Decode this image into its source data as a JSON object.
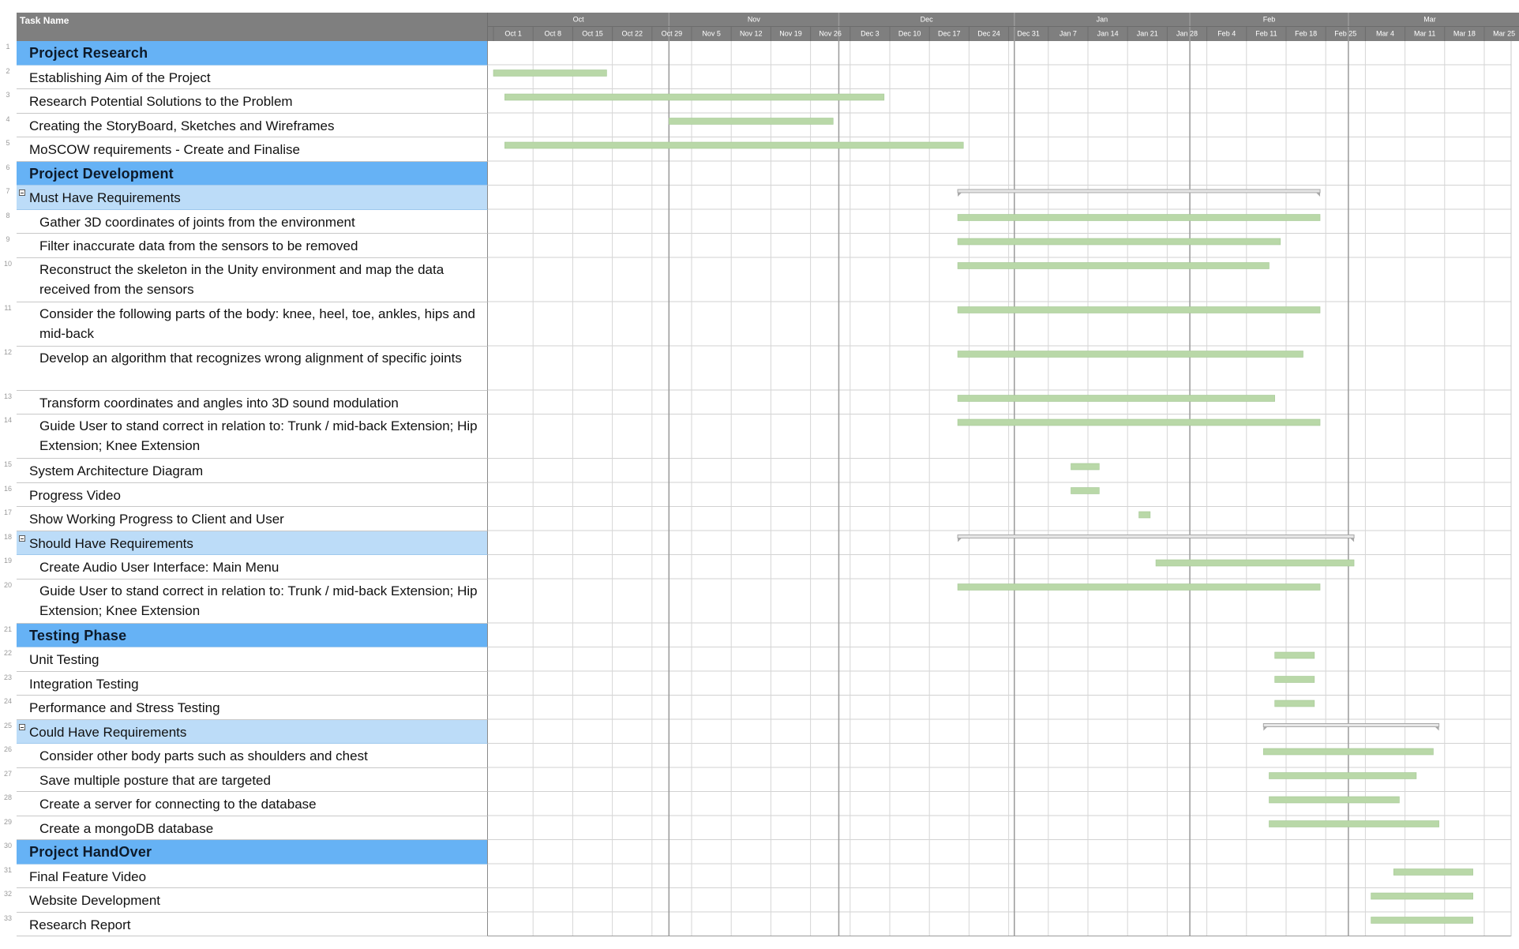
{
  "header": {
    "task_name_label": "Task Name"
  },
  "timeline": {
    "months": [
      "Oct",
      "Nov",
      "Dec",
      "Jan",
      "Feb",
      "Mar"
    ],
    "weeks": [
      "Oct 1",
      "Oct 8",
      "Oct 15",
      "Oct 22",
      "Oct 29",
      "Nov 5",
      "Nov 12",
      "Nov 19",
      "Nov 26",
      "Dec 3",
      "Dec 10",
      "Dec 17",
      "Dec 24",
      "Dec 31",
      "Jan 7",
      "Jan 14",
      "Jan 21",
      "Jan 28",
      "Feb 4",
      "Feb 11",
      "Feb 18",
      "Feb 25",
      "Mar 4",
      "Mar 11",
      "Mar 18",
      "Mar 25"
    ]
  },
  "colors": {
    "phase_row": "#66b2f5",
    "group_row": "#bcdcf8",
    "task_bar": "#b9d8a8",
    "summary_bar": "#a8a8a8",
    "header_bg": "#7f7f7f"
  },
  "tasks": [
    {
      "num": "1",
      "name": "Project Research",
      "type": "phase",
      "indent": 0,
      "lines": 1,
      "bar": null
    },
    {
      "num": "2",
      "name": "Establishing Aim of the Project",
      "type": "task",
      "indent": 1,
      "lines": 1,
      "bar": {
        "start": "Oct 1",
        "end": "Oct 20"
      }
    },
    {
      "num": "3",
      "name": "Research Potential Solutions to the Problem",
      "type": "task",
      "indent": 1,
      "lines": 1,
      "bar": {
        "start": "Oct 3",
        "end": "Dec 8"
      }
    },
    {
      "num": "4",
      "name": "Creating the StoryBoard, Sketches and Wireframes",
      "type": "task",
      "indent": 1,
      "lines": 1,
      "bar": {
        "start": "Nov 1",
        "end": "Nov 29"
      }
    },
    {
      "num": "5",
      "name": "MoSCOW requirements - Create and Finalise",
      "type": "task",
      "indent": 1,
      "lines": 1,
      "bar": {
        "start": "Oct 3",
        "end": "Dec 22"
      }
    },
    {
      "num": "6",
      "name": "Project Development",
      "type": "phase",
      "indent": 0,
      "lines": 1,
      "bar": null
    },
    {
      "num": "7",
      "name": "Must Have Requirements",
      "type": "group",
      "indent": 1,
      "lines": 1,
      "bar": {
        "start": "Dec 22",
        "end": "Feb 23",
        "summary": true
      }
    },
    {
      "num": "8",
      "name": "Gather 3D coordinates of joints from the environment",
      "type": "task",
      "indent": 2,
      "lines": 1,
      "bar": {
        "start": "Dec 22",
        "end": "Feb 23"
      }
    },
    {
      "num": "9",
      "name": "Filter inaccurate data from the sensors to be removed",
      "type": "task",
      "indent": 2,
      "lines": 1,
      "bar": {
        "start": "Dec 22",
        "end": "Feb 16"
      }
    },
    {
      "num": "10",
      "name": "Reconstruct the skeleton in the Unity environment and map the data received from the sensors",
      "type": "task",
      "indent": 2,
      "lines": 2,
      "bar": {
        "start": "Dec 22",
        "end": "Feb 14"
      }
    },
    {
      "num": "11",
      "name": "Consider the following parts of the body: knee, heel, toe, ankles, hips and mid-back",
      "type": "task",
      "indent": 2,
      "lines": 2,
      "bar": {
        "start": "Dec 22",
        "end": "Feb 23"
      }
    },
    {
      "num": "12",
      "name": "Develop an algorithm that recognizes wrong alignment of specific joints",
      "type": "task",
      "indent": 2,
      "lines": 2,
      "bar": {
        "start": "Dec 22",
        "end": "Feb 20"
      }
    },
    {
      "num": "13",
      "name": "Transform coordinates and angles into 3D sound modulation",
      "type": "task",
      "indent": 2,
      "lines": 1,
      "bar": {
        "start": "Dec 22",
        "end": "Feb 15"
      }
    },
    {
      "num": "14",
      "name": "Guide User to stand correct in relation to: Trunk / mid-back Extension; Hip Extension; Knee Extension",
      "type": "task",
      "indent": 2,
      "lines": 2,
      "bar": {
        "start": "Dec 22",
        "end": "Feb 23"
      }
    },
    {
      "num": "15",
      "name": "System Architecture Diagram",
      "type": "task",
      "indent": 1,
      "lines": 1,
      "bar": {
        "start": "Jan 11",
        "end": "Jan 15"
      }
    },
    {
      "num": "16",
      "name": "Progress Video",
      "type": "task",
      "indent": 1,
      "lines": 1,
      "bar": {
        "start": "Jan 11",
        "end": "Jan 15"
      }
    },
    {
      "num": "17",
      "name": "Show Working Progress to Client and User",
      "type": "task",
      "indent": 1,
      "lines": 1,
      "bar": {
        "start": "Jan 23",
        "end": "Jan 24"
      }
    },
    {
      "num": "18",
      "name": "Should Have Requirements",
      "type": "group",
      "indent": 1,
      "lines": 1,
      "bar": {
        "start": "Dec 22",
        "end": "Mar 1",
        "summary": true
      }
    },
    {
      "num": "19",
      "name": "Create Audio User Interface: Main Menu",
      "type": "task",
      "indent": 2,
      "lines": 1,
      "bar": {
        "start": "Jan 26",
        "end": "Mar 1"
      }
    },
    {
      "num": "20",
      "name": "Guide User to stand correct in relation to: Trunk / mid-back Extension; Hip Extension; Knee Extension",
      "type": "task",
      "indent": 2,
      "lines": 2,
      "bar": {
        "start": "Dec 22",
        "end": "Feb 23"
      }
    },
    {
      "num": "21",
      "name": "Testing Phase",
      "type": "phase",
      "indent": 0,
      "lines": 1,
      "bar": null
    },
    {
      "num": "22",
      "name": "Unit Testing",
      "type": "task",
      "indent": 1,
      "lines": 1,
      "bar": {
        "start": "Feb 16",
        "end": "Feb 22"
      }
    },
    {
      "num": "23",
      "name": "Integration Testing",
      "type": "task",
      "indent": 1,
      "lines": 1,
      "bar": {
        "start": "Feb 16",
        "end": "Feb 22"
      }
    },
    {
      "num": "24",
      "name": "Performance and Stress Testing",
      "type": "task",
      "indent": 1,
      "lines": 1,
      "bar": {
        "start": "Feb 16",
        "end": "Feb 22"
      }
    },
    {
      "num": "25",
      "name": "Could Have Requirements",
      "type": "group",
      "indent": 1,
      "lines": 1,
      "bar": {
        "start": "Feb 14",
        "end": "Mar 16",
        "summary": true
      }
    },
    {
      "num": "26",
      "name": "Consider other body parts such as shoulders and chest",
      "type": "task",
      "indent": 2,
      "lines": 1,
      "bar": {
        "start": "Feb 14",
        "end": "Mar 15"
      }
    },
    {
      "num": "27",
      "name": "Save multiple posture that are targeted",
      "type": "task",
      "indent": 2,
      "lines": 1,
      "bar": {
        "start": "Feb 15",
        "end": "Mar 12"
      }
    },
    {
      "num": "28",
      "name": "Create a server for connecting to the database",
      "type": "task",
      "indent": 2,
      "lines": 1,
      "bar": {
        "start": "Feb 15",
        "end": "Mar 9"
      }
    },
    {
      "num": "29",
      "name": "Create a mongoDB database",
      "type": "task",
      "indent": 2,
      "lines": 1,
      "bar": {
        "start": "Feb 15",
        "end": "Mar 16"
      }
    },
    {
      "num": "30",
      "name": "Project HandOver",
      "type": "phase",
      "indent": 0,
      "lines": 1,
      "bar": null
    },
    {
      "num": "31",
      "name": "Final Feature Video",
      "type": "task",
      "indent": 1,
      "lines": 1,
      "bar": {
        "start": "Mar 9",
        "end": "Mar 22"
      }
    },
    {
      "num": "32",
      "name": "Website Development",
      "type": "task",
      "indent": 1,
      "lines": 1,
      "bar": {
        "start": "Mar 5",
        "end": "Mar 22"
      }
    },
    {
      "num": "33",
      "name": "Research Report",
      "type": "task",
      "indent": 1,
      "lines": 1,
      "bar": {
        "start": "Mar 5",
        "end": "Mar 22"
      }
    }
  ]
}
